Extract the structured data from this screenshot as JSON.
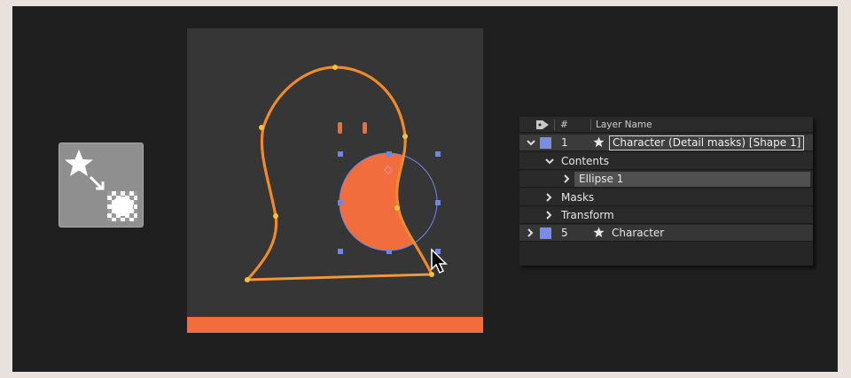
{
  "panel": {
    "header": {
      "number_col": "#",
      "name_col": "Layer Name"
    },
    "rows": [
      {
        "number": "1",
        "name": "Character (Detail masks) [Shape 1]",
        "label_color": "#7b8ce8",
        "expanded": true,
        "renaming": true
      },
      {
        "name": "Contents",
        "expanded": true
      },
      {
        "name": "Ellipse 1",
        "expanded": false,
        "selected": true
      },
      {
        "name": "Masks",
        "expanded": false
      },
      {
        "name": "Transform",
        "expanded": false
      },
      {
        "number": "5",
        "name": "Character",
        "label_color": "#7b8ce8",
        "expanded": false
      }
    ]
  },
  "colors": {
    "accent_orange": "#f26d3d",
    "path_orange": "#f28a2a",
    "handle_blue": "#6f86e8",
    "canvas_bg": "#363636"
  },
  "icons": {
    "tile": "star-to-mask-icon",
    "cursor": "arrow-cursor-icon",
    "layer_type": "star-shape-icon",
    "tag": "tag-icon"
  }
}
